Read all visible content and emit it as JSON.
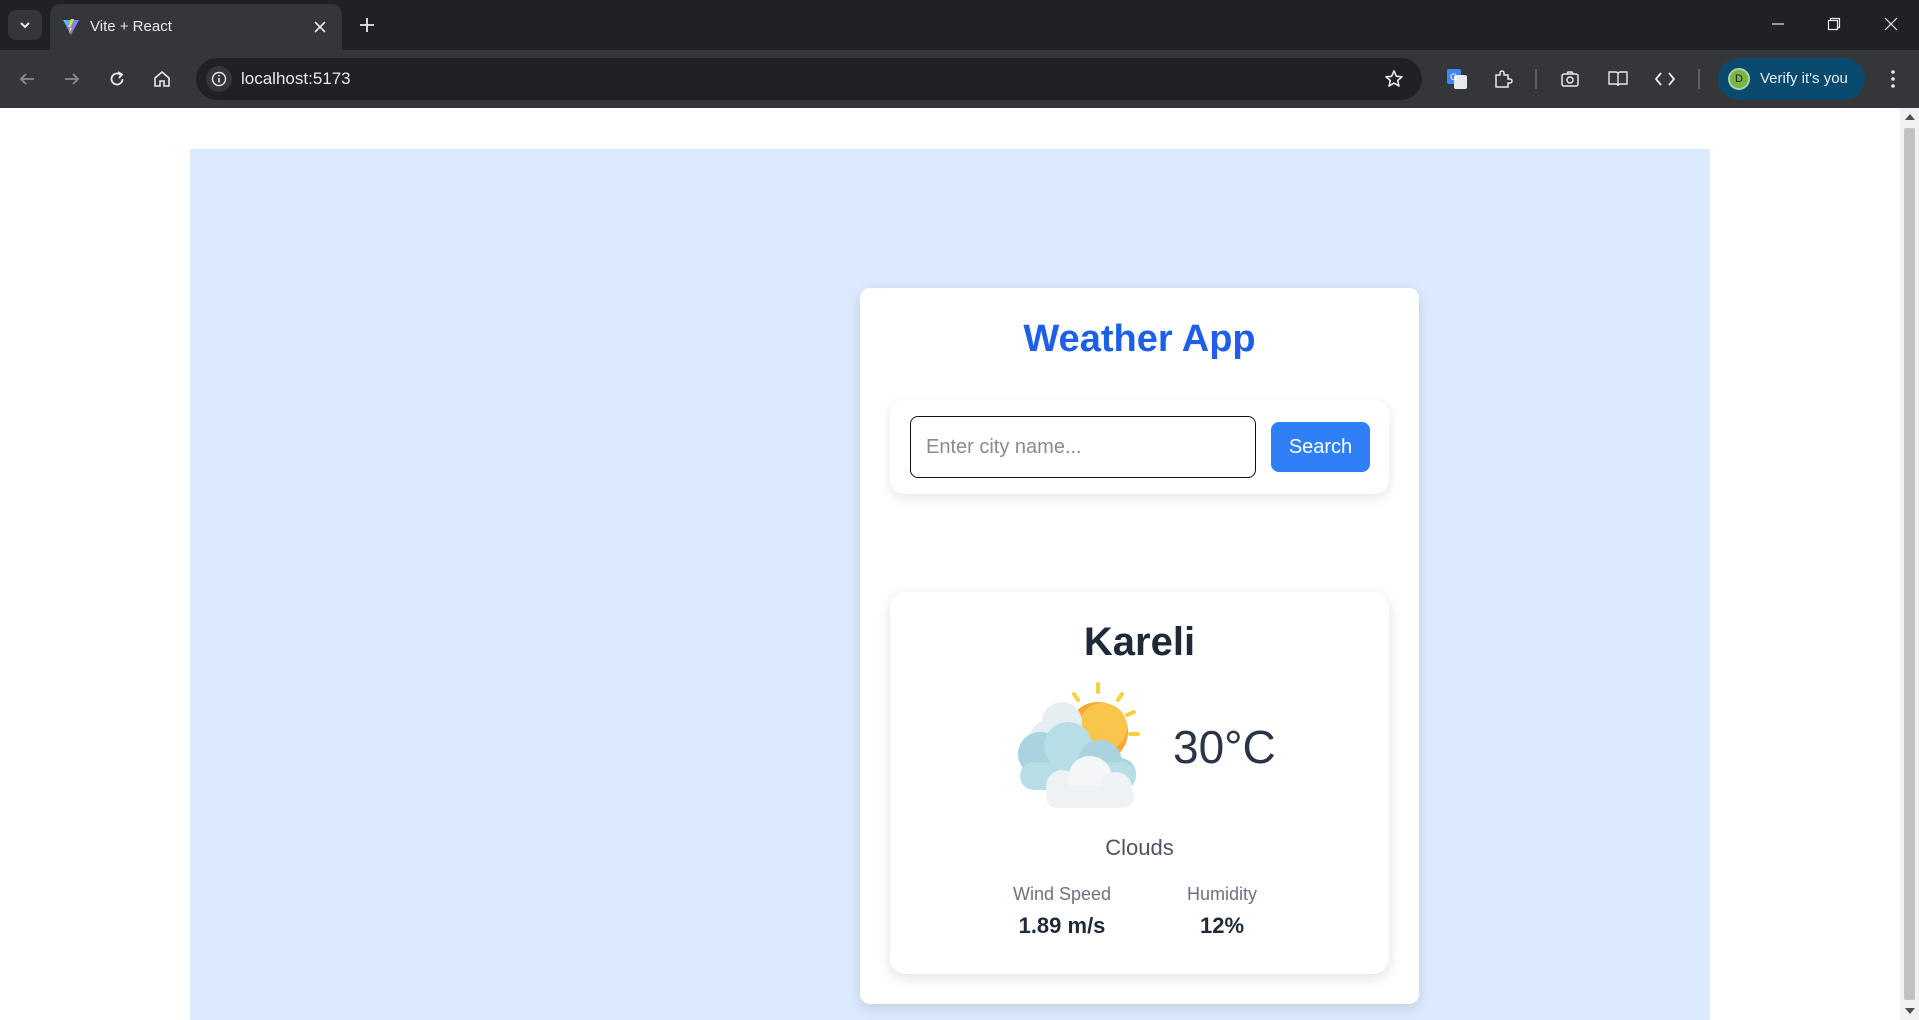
{
  "browser": {
    "tab_title": "Vite + React",
    "url": "localhost:5173",
    "profile_label": "Verify it's you",
    "profile_initial": "D"
  },
  "app": {
    "title": "Weather App",
    "search": {
      "placeholder": "Enter city name...",
      "value": "",
      "button_label": "Search"
    },
    "weather": {
      "city": "Kareli",
      "temperature": "30°C",
      "condition": "Clouds",
      "icon": "sun-behind-clouds-icon",
      "wind_label": "Wind Speed",
      "wind_value": "1.89 m/s",
      "humidity_label": "Humidity",
      "humidity_value": "12%"
    }
  },
  "colors": {
    "page_background": "#dbeafe",
    "title_blue": "#1d5fe8",
    "button_blue": "#2f80f6"
  }
}
